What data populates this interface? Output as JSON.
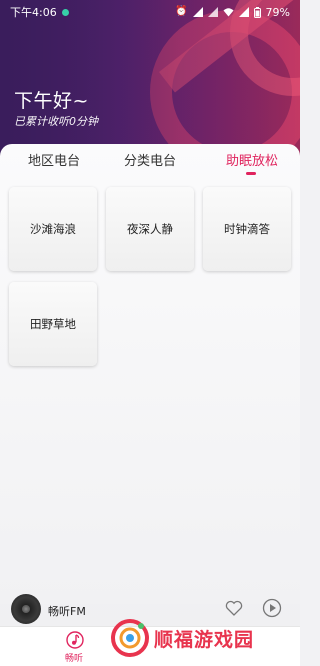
{
  "status_bar": {
    "time": "下午4:06",
    "battery": "79%"
  },
  "header": {
    "greeting": "下午好~",
    "listen_total": "已累计收听0分钟"
  },
  "tabs": [
    {
      "label": "地区电台",
      "active": false
    },
    {
      "label": "分类电台",
      "active": false
    },
    {
      "label": "助眠放松",
      "active": true
    }
  ],
  "tiles": [
    {
      "label": "沙滩海浪"
    },
    {
      "label": "夜深人静"
    },
    {
      "label": "时钟滴答"
    },
    {
      "label": "田野草地"
    }
  ],
  "player": {
    "title": "畅听FM"
  },
  "bottom_nav": {
    "items": [
      {
        "label": "畅听",
        "icon": "music-note-icon",
        "active": true
      }
    ]
  },
  "watermark": {
    "text": "顺福游戏园",
    "icon": "watermark-logo-icon"
  },
  "colors": {
    "accent": "#e0245e",
    "header_start": "#3a1d5c",
    "header_end": "#9a2a5a"
  }
}
